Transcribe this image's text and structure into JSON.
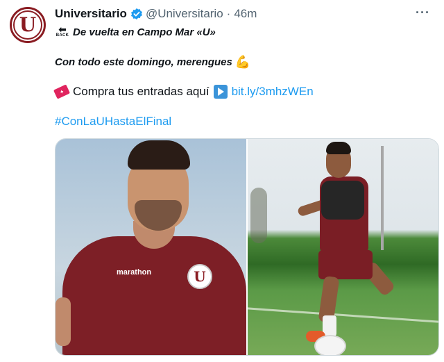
{
  "account": {
    "display_name": "Universitario",
    "handle": "@Universitario",
    "separator": "·",
    "time": "46m",
    "avatar_letter": "U"
  },
  "tweet": {
    "back_icon_text": "BACK",
    "line1": "De vuelta en Campo Mar «U»",
    "line2": "Con todo este domingo, merengues",
    "line3_text": "Compra tus entradas aquí",
    "line3_link": "bit.ly/3mhzWEn",
    "hashtag": "#ConLaUHastaElFinal"
  },
  "media": {
    "left_shirt_brand": "marathon",
    "left_crest_letter": "U"
  },
  "icons": {
    "verified": "verified-badge-icon",
    "more": "more-options-icon",
    "back": "back-arrow-icon",
    "flex": "flexed-biceps-icon",
    "ticket": "ticket-icon",
    "play": "play-button-icon"
  },
  "colors": {
    "link": "#1d9bf0",
    "secondary_text": "#536471",
    "club": "#8a1c22"
  }
}
